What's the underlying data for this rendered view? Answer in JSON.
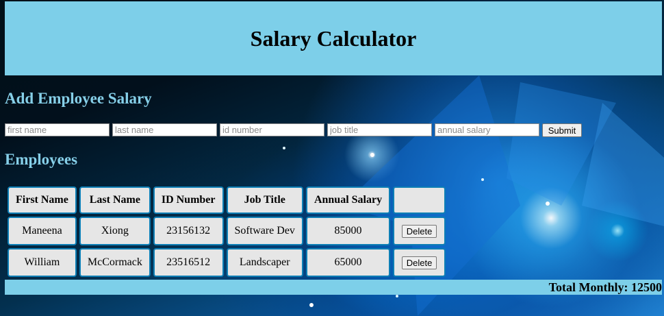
{
  "header": {
    "title": "Salary Calculator"
  },
  "add_section": {
    "title": "Add Employee Salary"
  },
  "form": {
    "first_name_placeholder": "first name",
    "last_name_placeholder": "last name",
    "id_number_placeholder": "id number",
    "job_title_placeholder": "job title",
    "annual_salary_placeholder": "annual salary",
    "submit_label": "Submit"
  },
  "employees_section": {
    "title": "Employees"
  },
  "table": {
    "headers": [
      "First Name",
      "Last Name",
      "ID Number",
      "Job Title",
      "Annual Salary",
      ""
    ],
    "rows": [
      {
        "first_name": "Maneena",
        "last_name": "Xiong",
        "id_number": "23156132",
        "job_title": "Software Dev",
        "annual_salary": "85000",
        "action_label": "Delete"
      },
      {
        "first_name": "William",
        "last_name": "McCormack",
        "id_number": "23516512",
        "job_title": "Landscaper",
        "annual_salary": "65000",
        "action_label": "Delete"
      }
    ]
  },
  "footer": {
    "total_monthly": "Total Monthly: 12500"
  },
  "colors": {
    "banner": "#7dcfe9",
    "section_title": "#86cfe8",
    "cell_background": "#e6e6e6",
    "cell_border": "#0d7fb6"
  }
}
